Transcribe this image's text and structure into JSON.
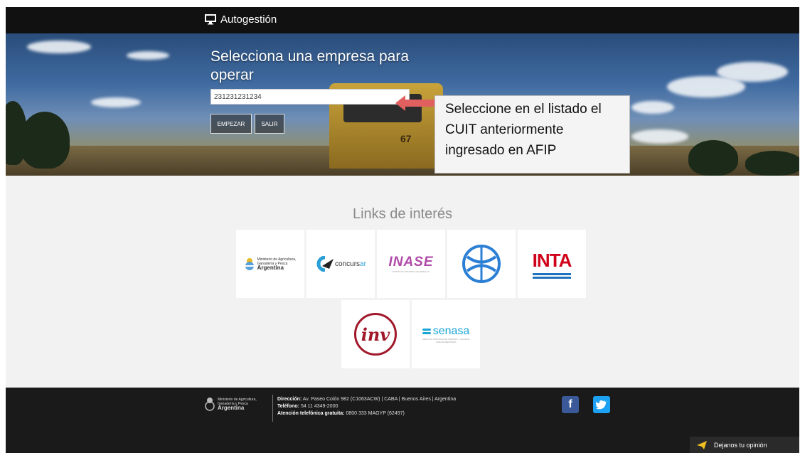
{
  "header": {
    "brand": "Autogestión"
  },
  "hero": {
    "title": "Selecciona una empresa para operar",
    "cuit_value": "231231231234",
    "buttons": {
      "start": "EMPEZAR",
      "exit": "SALIR"
    },
    "harvester_number": "67",
    "callout": "Seleccione en el listado el CUIT anteriormente ingresado en AFIP"
  },
  "links": {
    "title": "Links de interés",
    "items": [
      {
        "name": "Ministerio de Agricultura, Ganadería y Pesca",
        "line1": "Ministerio de Agricultura,",
        "line2": "Ganadería y Pesca",
        "line3": "Argentina"
      },
      {
        "name": "concursar",
        "text_a": "concurs",
        "text_b": "ar"
      },
      {
        "name": "INALSE",
        "text": "INASE",
        "sub": "INSTITUTO NACIONAL DE SEMILLAS"
      },
      {
        "name": "fish-circle"
      },
      {
        "name": "INTA",
        "text": "INTA"
      },
      {
        "name": "INV",
        "text": "inv"
      },
      {
        "name": "SENASA",
        "text": "senasa",
        "sub": "SERVICIO NACIONAL DE SANIDAD Y CALIDAD AGROALIMENTARIA"
      }
    ]
  },
  "footer": {
    "logo_line1": "Ministerio de Agricultura,",
    "logo_line2": "Ganadería y Pesca",
    "logo_line3": "Argentina",
    "address_label": "Dirección:",
    "address": "Av. Paseo Colón 982 (C1063ACW) | CABA | Buenos Aires | Argentina",
    "phone_label": "Teléfono:",
    "phone": "54 11 4349-2000",
    "free_label": "Atención telefónica gratuita:",
    "free": "0800 333 MAGYP (62497)",
    "social": {
      "facebook": "f",
      "twitter": "t"
    },
    "feedback": "Dejanos tu opinión"
  },
  "colors": {
    "accent_arrow": "#e06060",
    "inta_red": "#d0021b",
    "inta_blue": "#1e73be",
    "inv_red": "#a0182a",
    "senasa_blue": "#1aa5d6"
  }
}
